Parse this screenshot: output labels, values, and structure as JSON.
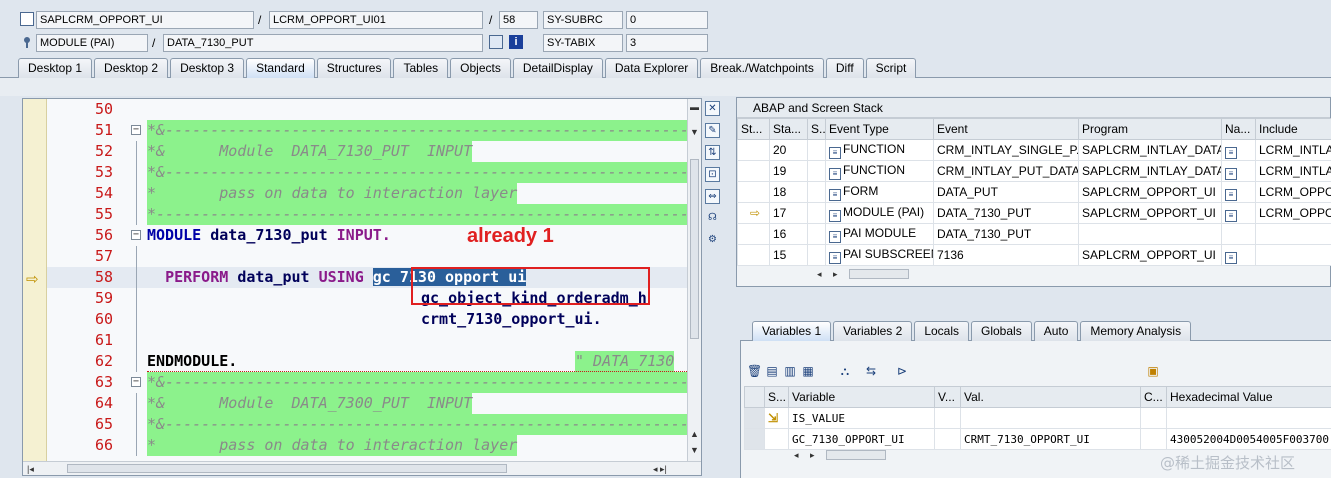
{
  "header": {
    "program": "SAPLCRM_OPPORT_UI",
    "include": "LCRM_OPPORT_UI01",
    "line": "58",
    "sy_subrc_label": "SY-SUBRC",
    "sy_subrc_value": "0",
    "event_type": "MODULE (PAI)",
    "event": "DATA_7130_PUT",
    "sy_tabix_label": "SY-TABIX",
    "sy_tabix_value": "3",
    "sep": "/"
  },
  "tabs": [
    "Desktop 1",
    "Desktop 2",
    "Desktop 3",
    "Standard",
    "Structures",
    "Tables",
    "Objects",
    "DetailDisplay",
    "Data Explorer",
    "Break./Watchpoints",
    "Diff",
    "Script"
  ],
  "active_tab": "Standard",
  "code": {
    "lines": [
      {
        "num": "50",
        "text": ""
      },
      {
        "num": "51",
        "text": "*&---------------------------------------------------------------------*"
      },
      {
        "num": "52",
        "text": "*&      Module  DATA_7130_PUT  INPUT"
      },
      {
        "num": "53",
        "text": "*&---------------------------------------------------------------------*"
      },
      {
        "num": "54",
        "text": "*       pass on data to interaction layer"
      },
      {
        "num": "55",
        "text": "*----------------------------------------------------------------------*"
      },
      {
        "num": "56",
        "text": "MODULE data_7130_put INPUT."
      },
      {
        "num": "57",
        "text": ""
      },
      {
        "num": "58",
        "text": "  PERFORM data_put USING gc_7130_opport_ui"
      },
      {
        "num": "59",
        "text": "gc_object_kind_orderadm_h"
      },
      {
        "num": "60",
        "text": "crmt_7130_opport_ui."
      },
      {
        "num": "61",
        "text": ""
      },
      {
        "num": "62",
        "text": "ENDMODULE."
      },
      {
        "num": "63",
        "text": "*&---------------------------------------------------------------------*"
      },
      {
        "num": "64",
        "text": "*&      Module  DATA_7300_PUT  INPUT"
      },
      {
        "num": "65",
        "text": "*&---------------------------------------------------------------------*"
      },
      {
        "num": "66",
        "text": "*       pass on data to interaction layer"
      }
    ],
    "l56_kw1": "MODULE",
    "l56_name": "data_7130_put",
    "l56_kw2": "INPUT.",
    "l58_kw": "PERFORM",
    "l58_name": "data_put",
    "l58_kw2": "USING",
    "l58_sel": "gc 7130 opport ui",
    "l62_kw": "ENDMODULE.",
    "l62_cmt": "\" DATA_7130",
    "annotation": "already 1"
  },
  "stack": {
    "title": "ABAP and Screen Stack",
    "columns": [
      "St...",
      "Sta...",
      "S...",
      "Event Type",
      "Event",
      "Program",
      "Na...",
      "Include"
    ],
    "rows": [
      {
        "arrow": "",
        "level": "20",
        "type": "FUNCTION",
        "event": "CRM_INTLAY_SINGLE_P...",
        "program": "SAPLCRM_INTLAY_DATA",
        "include": "LCRM_INTLA"
      },
      {
        "arrow": "",
        "level": "19",
        "type": "FUNCTION",
        "event": "CRM_INTLAY_PUT_DATA",
        "program": "SAPLCRM_INTLAY_DATA",
        "include": "LCRM_INTLA"
      },
      {
        "arrow": "",
        "level": "18",
        "type": "FORM",
        "event": "DATA_PUT",
        "program": "SAPLCRM_OPPORT_UI",
        "include": "LCRM_OPPO"
      },
      {
        "arrow": "⇨",
        "level": "17",
        "type": "MODULE (PAI)",
        "event": "DATA_7130_PUT",
        "program": "SAPLCRM_OPPORT_UI",
        "include": "LCRM_OPPO"
      },
      {
        "arrow": "",
        "level": "16",
        "type": "PAI MODULE",
        "event": "DATA_7130_PUT",
        "program": "",
        "include": ""
      },
      {
        "arrow": "",
        "level": "15",
        "type": "PAI SUBSCREEN",
        "event": "7136",
        "program": "SAPLCRM_OPPORT_UI",
        "include": ""
      }
    ]
  },
  "var_tabs": [
    "Variables 1",
    "Variables 2",
    "Locals",
    "Globals",
    "Auto",
    "Memory Analysis"
  ],
  "active_var_tab": "Variables 1",
  "variables": {
    "columns": [
      "S...",
      "Variable",
      "V...",
      "Val.",
      "C...",
      "Hexadecimal Value"
    ],
    "rows": [
      {
        "variable": "IS_VALUE",
        "value": "",
        "hex": ""
      },
      {
        "variable": "GC_7130_OPPORT_UI",
        "value": "CRMT_7130_OPPORT_UI",
        "hex": "430052004D0054005F003700"
      }
    ]
  },
  "watermark": "@稀土掘金技术社区",
  "colors": {
    "accent": "#2a5f9a",
    "annotation": "#e02020",
    "comment_bg": "#8cf28c"
  }
}
